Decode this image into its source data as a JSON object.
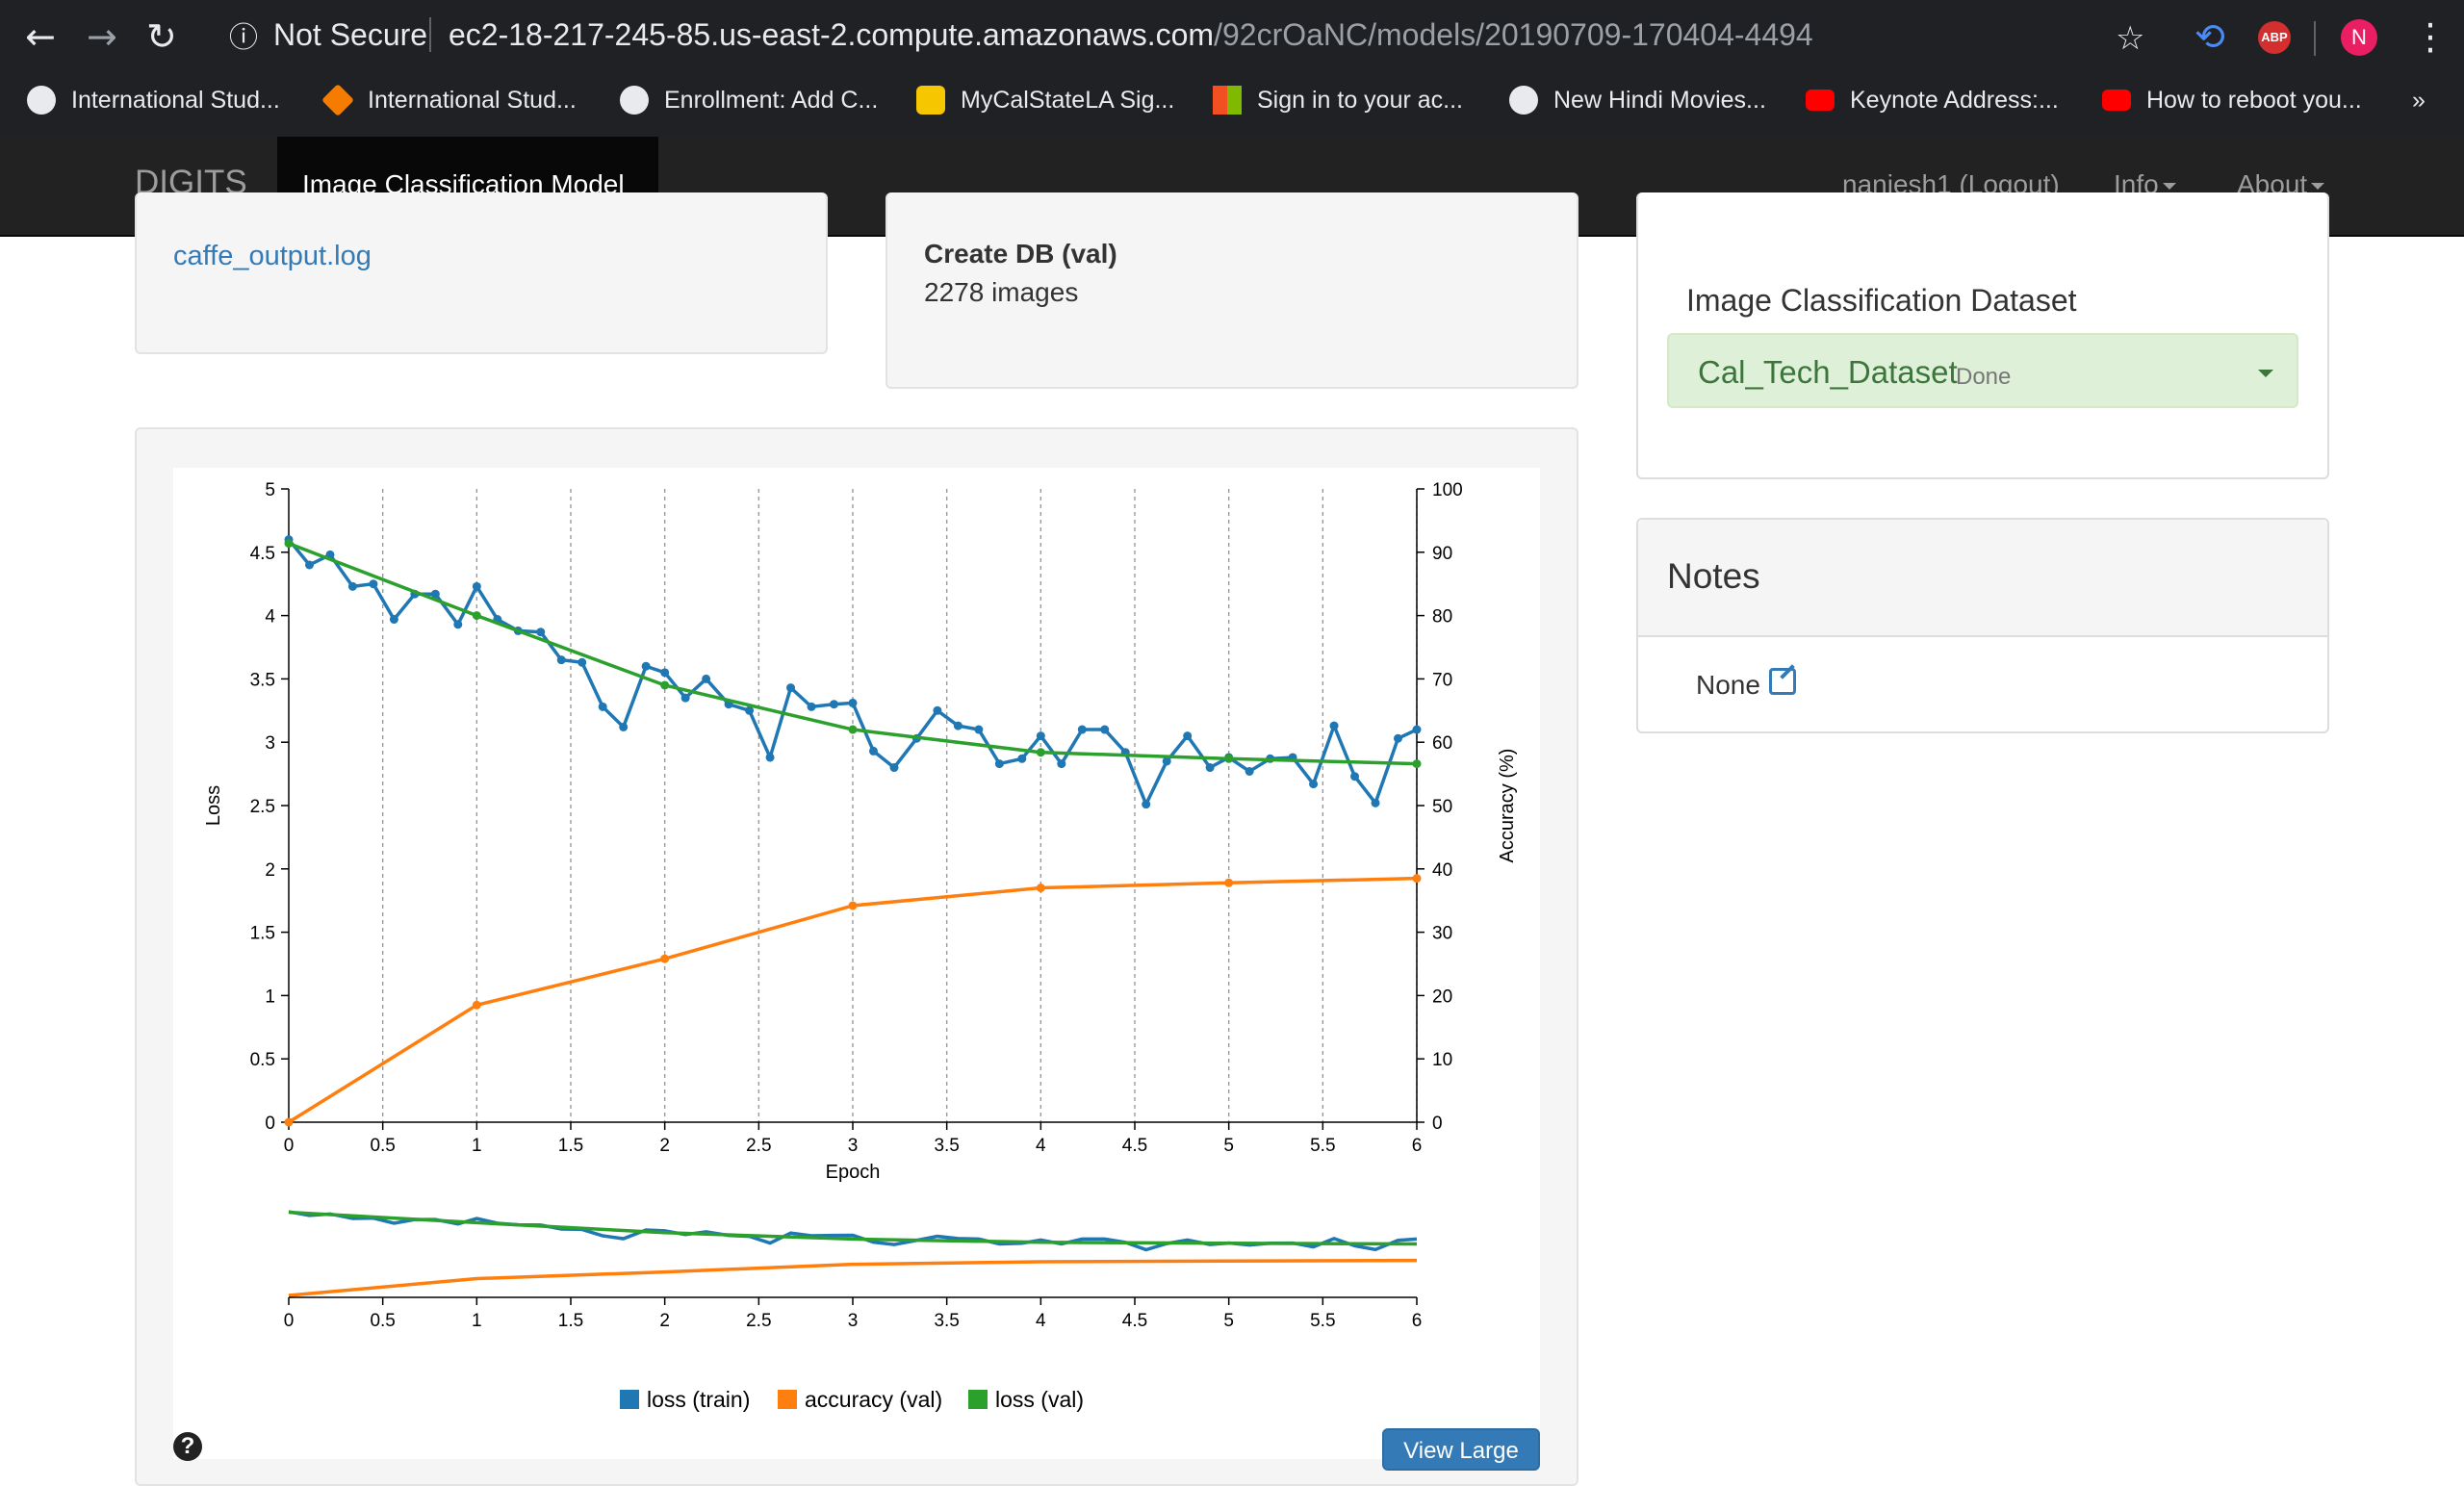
{
  "browser": {
    "url_host": "ec2-18-217-245-85.us-east-2.compute.amazonaws.com",
    "url_path": "/92crOaNC/models/20190709-170404-4494",
    "security_label": "Not Secure",
    "profile_initial": "N",
    "abp_label": "ABP",
    "bookmarks": [
      {
        "label": "International Stud...",
        "icon": "globe-icon"
      },
      {
        "label": "International Stud...",
        "icon": "diamond-logo-icon"
      },
      {
        "label": "Enrollment: Add C...",
        "icon": "globe-icon"
      },
      {
        "label": "MyCalStateLA Sig...",
        "icon": "shield-logo-icon"
      },
      {
        "label": "Sign in to your ac...",
        "icon": "microsoft-logo-icon"
      },
      {
        "label": "New Hindi Movies...",
        "icon": "globe-icon"
      },
      {
        "label": "Keynote Address:...",
        "icon": "youtube-icon"
      },
      {
        "label": "How to reboot you...",
        "icon": "youtube-icon"
      }
    ],
    "overflow": "»"
  },
  "navbar": {
    "brand": "DIGITS",
    "active_tab": "Image Classification Model",
    "user": "nanjesh1 (Logout)",
    "info": "Info",
    "about": "About"
  },
  "files": {
    "link": "caffe_output.log"
  },
  "dbinfo": {
    "title": "Create DB (val)",
    "count": "2278 images"
  },
  "dataset": {
    "heading": "Image Classification Dataset",
    "name": "Cal_Tech_Dataset",
    "status": "Done"
  },
  "notes": {
    "heading": "Notes",
    "value": "None"
  },
  "buttons": {
    "view_large": "View Large",
    "help": "?"
  },
  "colors": {
    "loss_train": "#1f77b4",
    "accuracy_val": "#ff7f0e",
    "loss_val": "#2ca02c",
    "link": "#337ab7",
    "navbar": "#222222"
  },
  "chart_data": {
    "type": "line",
    "xlabel": "Epoch",
    "ylabel": "Loss",
    "y2label": "Accuracy (%)",
    "xlim": [
      0,
      6
    ],
    "ylim": [
      0,
      5
    ],
    "y2lim": [
      0,
      100
    ],
    "x_ticks": [
      "0",
      "0.5",
      "1",
      "1.5",
      "2",
      "2.5",
      "3",
      "3.5",
      "4",
      "4.5",
      "5",
      "5.5",
      "6"
    ],
    "y_ticks": [
      "0",
      "0.5",
      "1",
      "1.5",
      "2",
      "2.5",
      "3",
      "3.5",
      "4",
      "4.5",
      "5"
    ],
    "y2_ticks": [
      "0",
      "10",
      "20",
      "30",
      "40",
      "50",
      "60",
      "70",
      "80",
      "90",
      "100"
    ],
    "grid": "vertical dashed",
    "legend_position": "bottom",
    "series": [
      {
        "name": "loss (train)",
        "axis": "left",
        "x": [
          0,
          0.11,
          0.22,
          0.34,
          0.45,
          0.56,
          0.67,
          0.78,
          0.9,
          1,
          1.11,
          1.22,
          1.34,
          1.45,
          1.56,
          1.67,
          1.78,
          1.9,
          2,
          2.11,
          2.22,
          2.34,
          2.45,
          2.56,
          2.67,
          2.78,
          2.9,
          3,
          3.11,
          3.22,
          3.34,
          3.45,
          3.56,
          3.67,
          3.78,
          3.9,
          4,
          4.11,
          4.22,
          4.34,
          4.45,
          4.56,
          4.67,
          4.78,
          4.9,
          5,
          5.11,
          5.22,
          5.34,
          5.45,
          5.56,
          5.67,
          5.78,
          5.9,
          6
        ],
        "y": [
          4.6,
          4.4,
          4.48,
          4.23,
          4.25,
          3.97,
          4.17,
          4.17,
          3.93,
          4.23,
          3.97,
          3.88,
          3.87,
          3.65,
          3.63,
          3.28,
          3.12,
          3.6,
          3.55,
          3.35,
          3.5,
          3.3,
          3.25,
          2.88,
          3.43,
          3.28,
          3.3,
          3.31,
          2.93,
          2.8,
          3.03,
          3.25,
          3.13,
          3.1,
          2.83,
          2.87,
          3.05,
          2.83,
          3.1,
          3.1,
          2.92,
          2.51,
          2.85,
          3.05,
          2.8,
          2.88,
          2.77,
          2.87,
          2.88,
          2.67,
          3.13,
          2.73,
          2.52,
          3.03,
          3.1
        ]
      },
      {
        "name": "accuracy (val)",
        "axis": "right",
        "x": [
          0,
          1,
          2,
          3,
          4,
          5,
          6
        ],
        "y": [
          0,
          18.5,
          25.8,
          34.2,
          37,
          37.8,
          38.5
        ]
      },
      {
        "name": "loss (val)",
        "axis": "left",
        "x": [
          0,
          1,
          2,
          3,
          4,
          5,
          6
        ],
        "y": [
          4.57,
          4.0,
          3.45,
          3.1,
          2.92,
          2.87,
          2.83
        ]
      }
    ]
  }
}
